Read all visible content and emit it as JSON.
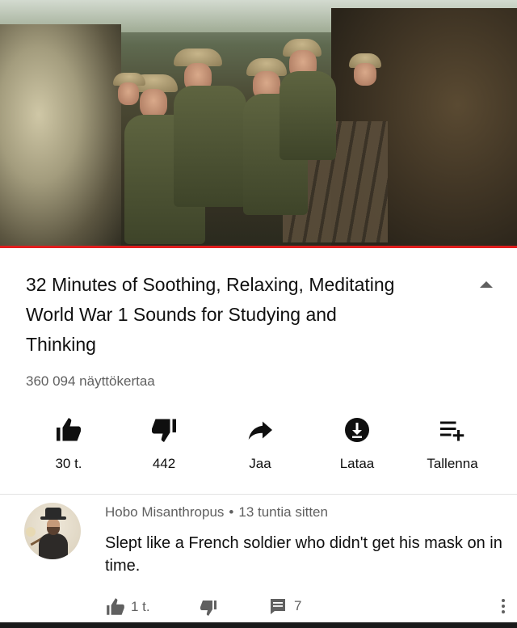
{
  "video": {
    "title": "32 Minutes of Soothing, Relaxing, Meditating World War 1 Sounds for Studying and Thinking",
    "views": "360 094 näyttökertaa"
  },
  "actions": [
    {
      "label": "30 t.",
      "icon": "thumbs-up-icon"
    },
    {
      "label": "442",
      "icon": "thumbs-down-icon"
    },
    {
      "label": "Jaa",
      "icon": "share-icon"
    },
    {
      "label": "Lataa",
      "icon": "download-icon"
    },
    {
      "label": "Tallenna",
      "icon": "save-playlist-icon"
    }
  ],
  "comment": {
    "author": "Hobo Misanthropus",
    "separator": "•",
    "time": "13 tuntia sitten",
    "text": "Slept like a French soldier who didn't get his mask on in time.",
    "likes": "1 t.",
    "replies": "7"
  },
  "colors": {
    "accent_red": "#e01e1e",
    "icon_gray": "#606060",
    "text": "#0f0f0f"
  }
}
